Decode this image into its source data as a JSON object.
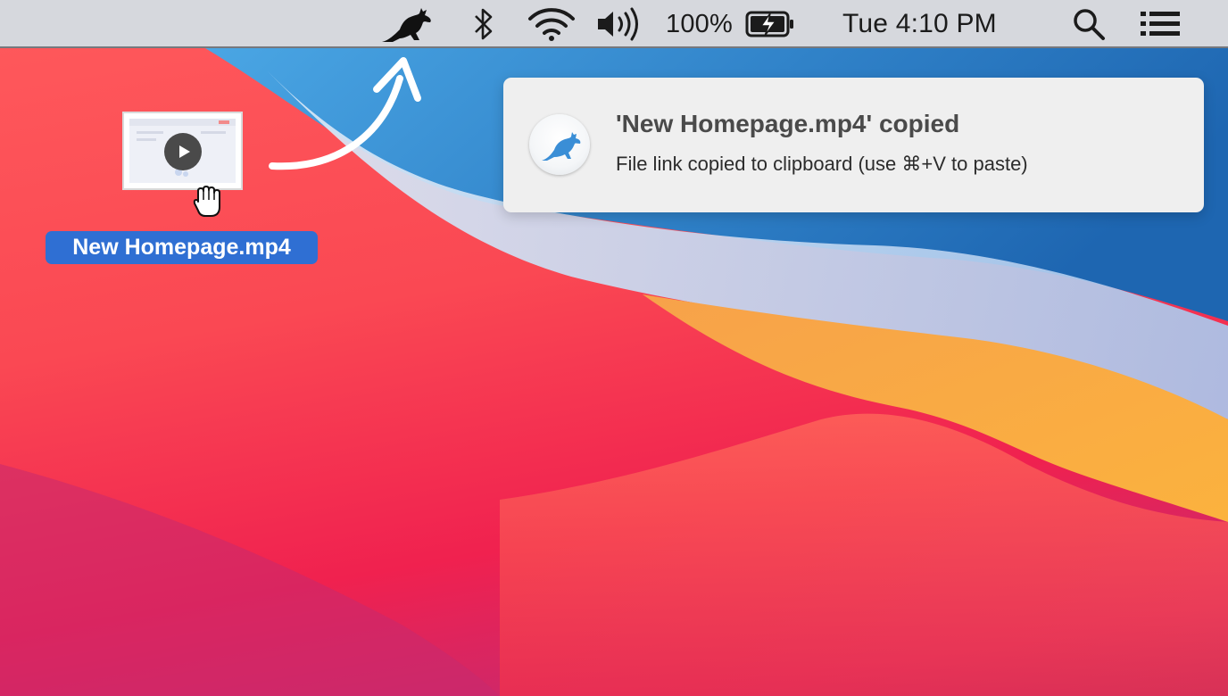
{
  "menubar": {
    "app_icon": "kangaroo-icon",
    "bluetooth_icon": "bluetooth-icon",
    "wifi_icon": "wifi-icon",
    "volume_icon": "volume-icon",
    "battery_percent": "100%",
    "battery_icon": "battery-charging-icon",
    "clock": "Tue 4:10 PM",
    "search_icon": "search-icon",
    "menu_icon": "list-icon"
  },
  "notification": {
    "icon": "kangaroo-icon",
    "title": "'New Homepage.mp4' copied",
    "body": "File link copied to clipboard (use ⌘+V to paste)",
    "accent_color": "#3a8ed6"
  },
  "desktop": {
    "file_name": "New Homepage.mp4",
    "file_icon": "video-file-icon",
    "play_icon": "play-icon",
    "cursor_icon": "grab-hand-icon",
    "arrow_icon": "curved-arrow-icon",
    "selection_color": "#2f6fd3"
  }
}
